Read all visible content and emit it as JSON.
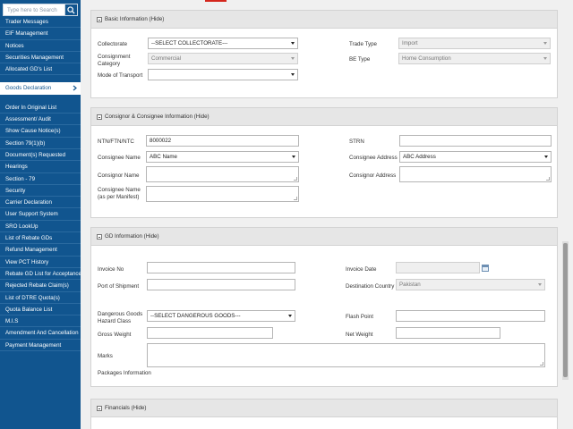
{
  "sidebar": {
    "search_placeholder": "Type here to Search",
    "items_top": [
      "Trader Messages",
      "EIF Management",
      "Notices",
      "Securities Management",
      "Allocated GD's List"
    ],
    "active_item": "Goods Declaration",
    "items_bottom": [
      "Order In Original List",
      "Assessment/ Audit",
      "Show Cause Notice(s)",
      "Section 79(1)(b)",
      "Document(s) Requested",
      "Hearings",
      "Section - 79",
      "Security",
      "Carrier Declaration",
      "User Support System",
      "SRO LookUp",
      "List of Rebate GDs",
      "Refund Management",
      "View PCT History",
      "Rebate GD List for Acceptance",
      "Rejected Rebate Claim(s)",
      "List of DTRE Quota(s)",
      "Quota Balance List",
      "M.I.S",
      "Amendment And Cancellation",
      "Payment Management"
    ]
  },
  "basic": {
    "title": "Basic Information (Hide)",
    "collectorate_label": "Collectorate",
    "collectorate_value": "--SELECT COLLECTORATE---",
    "consignment_category_label": "Consignment Category",
    "consignment_category_value": "Commercial",
    "mode_of_transport_label": "Mode of Transport",
    "mode_of_transport_value": "",
    "trade_type_label": "Trade Type",
    "trade_type_value": "Import",
    "be_type_label": "BE Type",
    "be_type_value": "Home Consumption"
  },
  "consignor": {
    "title": "Consignor & Consignee Information (Hide)",
    "ntn_label": "NTN/FTN/NTC",
    "ntn_value": "8000022",
    "consignee_name_label": "Consignee Name",
    "consignee_name_value": "ABC Name",
    "consignor_name_label": "Consignor Name",
    "consignee_name_manifest_label": "Consignee Name (as per Manifest)",
    "strn_label": "STRN",
    "consignee_address_label": "Consignee Address",
    "consignee_address_value": "ABC Address",
    "consignor_address_label": "Consignor Address"
  },
  "gd": {
    "title": "GD Information (Hide)",
    "invoice_no_label": "Invoice No",
    "port_of_shipment_label": "Port of Shipment",
    "dangerous_goods_label": "Dangerous Goods Hazard Class",
    "dangerous_goods_value": "--SELECT DANGEROUS GOODS---",
    "gross_weight_label": "Gross Weight",
    "marks_label": "Marks",
    "packages_label": "Packages Information",
    "invoice_date_label": "Invoice Date",
    "destination_country_label": "Destination Country",
    "destination_country_value": "Pakistan",
    "flash_point_label": "Flash Point",
    "net_weight_label": "Net Weight"
  },
  "financials": {
    "title": "Financials (Hide)"
  },
  "colors": {
    "sidebar": "#11558f",
    "panel_header": "#e6e6e6",
    "accent_mark": "#d4261c"
  }
}
